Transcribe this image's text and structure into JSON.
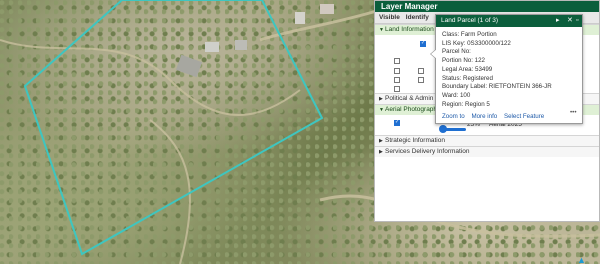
{
  "window": {
    "title": "Layer Manager"
  },
  "tabs": [
    "Visible",
    "Identify"
  ],
  "groups": {
    "land_information": "Land Information",
    "political_admin": "Political & Admin",
    "aerial_photography": "Aerial Photograph",
    "strategic_information": "Strategic Information",
    "services_delivery": "Services Delivery Information"
  },
  "aerial_layer": {
    "opacity_label": "25%",
    "name": "Aerial 2025",
    "opacity": 0.25
  },
  "popup": {
    "title": "Land Parcel (1 of 3)",
    "fields": [
      "Class: Farm Portion",
      "LIS Key: 0S3300000/122",
      "Parcel No:",
      "Portion No: 122",
      "Legal Area: 53499",
      "Status: Registered",
      "Boundary Label: RIETFONTEIN 366-JR",
      "Ward: 100",
      "Region: Region 5"
    ],
    "links": [
      "Zoom to",
      "More info",
      "Select Feature"
    ],
    "more_label": "•••"
  },
  "colors": {
    "header": "#0b5e3c",
    "parcel_outline": "#3ec6c0",
    "accent": "#1f6fd1"
  },
  "icons": [
    "play-icon",
    "close-icon",
    "maximize-icon",
    "caret-icon",
    "checkbox-icon",
    "navigation-icon"
  ]
}
